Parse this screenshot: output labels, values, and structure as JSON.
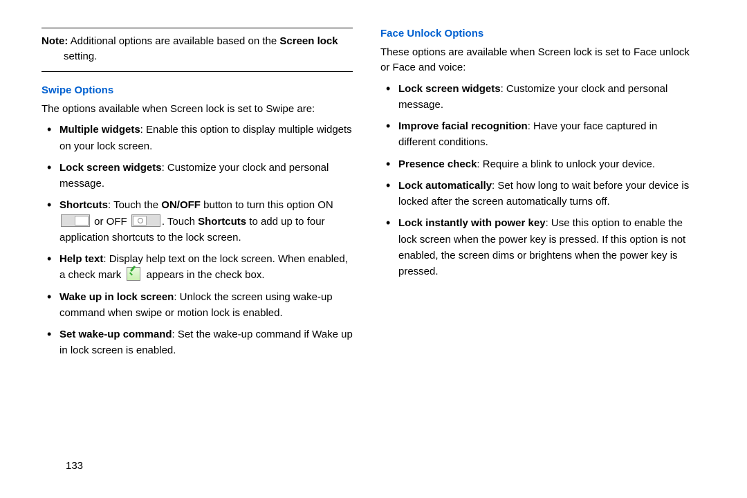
{
  "note": {
    "label": "Note:",
    "text_before_bold": " Additional options are available based on the ",
    "bold": "Screen lock",
    "text_after_bold": " setting."
  },
  "swipe": {
    "heading": "Swipe Options",
    "intro": "The options available when Screen lock is set to Swipe are:",
    "items": {
      "multiple_widgets": {
        "title": "Multiple widgets",
        "text": ": Enable this option to display multiple widgets on your lock screen."
      },
      "lock_widgets": {
        "title": "Lock screen widgets",
        "text": ": Customize your clock and personal message."
      },
      "shortcuts": {
        "title": "Shortcuts",
        "t1": ": Touch the ",
        "onoff": "ON/OFF",
        "t2": " button to turn this option ON ",
        "t3": " or OFF ",
        "t4": ". Touch ",
        "shortcuts_word": "Shortcuts",
        "t5": " to add up to four application shortcuts to the lock screen."
      },
      "help_text": {
        "title": "Help text",
        "t1": ": Display help text on the lock screen. When enabled, a check mark ",
        "t2": " appears in the check box."
      },
      "wake_up": {
        "title": "Wake up in lock screen",
        "text": ": Unlock the screen using wake-up command when swipe or motion lock is enabled."
      },
      "set_wake": {
        "title": "Set wake-up command",
        "text": ": Set the wake-up command if Wake up in lock screen is enabled."
      }
    }
  },
  "face": {
    "heading": "Face Unlock Options",
    "intro": "These options are available when Screen lock is set to Face unlock or Face and voice:",
    "items": {
      "lock_widgets": {
        "title": "Lock screen widgets",
        "text": ": Customize your clock and personal message."
      },
      "improve": {
        "title": "Improve facial recognition",
        "text": ": Have your face captured in different conditions."
      },
      "presence": {
        "title": "Presence check",
        "text": ": Require a blink to unlock your device."
      },
      "lock_auto": {
        "title": "Lock automatically",
        "text": ": Set how long to wait before your device is locked after the screen automatically turns off."
      },
      "lock_instant": {
        "title": "Lock instantly with power key",
        "text": ": Use this option to enable the lock screen when the power key is pressed. If this option is not enabled, the screen dims or brightens when the power key is pressed."
      }
    }
  },
  "page_number": "133"
}
